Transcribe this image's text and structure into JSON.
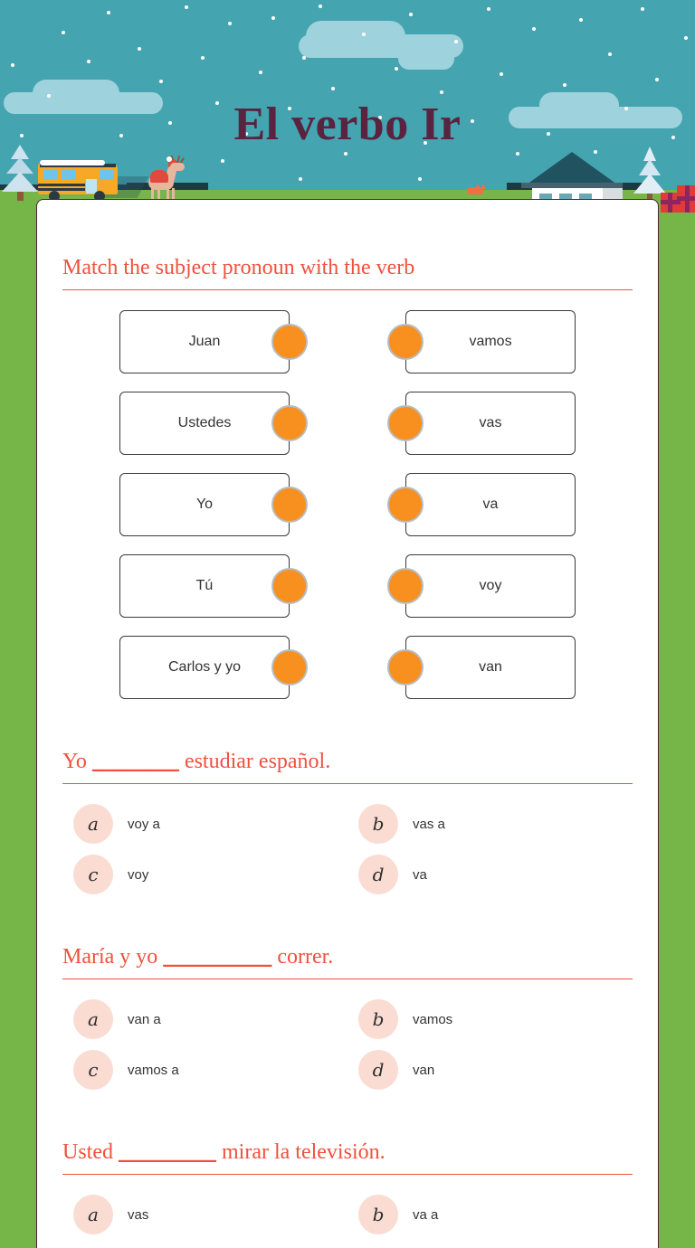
{
  "page": {
    "title": "El verbo Ir",
    "theme_colors": {
      "sky": "#44a4b0",
      "grass": "#76b547",
      "title": "#5a2340",
      "accent_red": "#f0503c",
      "match_dot": "#f7901e",
      "option_circle": "#fadcd2"
    }
  },
  "matching": {
    "heading": "Match the subject pronoun with the verb",
    "rows": [
      {
        "left": "Juan",
        "right": "vamos"
      },
      {
        "left": "Ustedes",
        "right": "vas"
      },
      {
        "left": "Yo",
        "right": "va"
      },
      {
        "left": "Tú",
        "right": "voy"
      },
      {
        "left": "Carlos y yo",
        "right": "van"
      }
    ]
  },
  "questions": [
    {
      "prefix": "Yo ",
      "blank": "________",
      "suffix": " estudiar español.",
      "full_text": "Yo ________ estudiar español.",
      "options": [
        {
          "letter": "a",
          "text": "voy a"
        },
        {
          "letter": "b",
          "text": "vas a"
        },
        {
          "letter": "c",
          "text": "voy"
        },
        {
          "letter": "d",
          "text": "va"
        }
      ]
    },
    {
      "prefix": "María y yo ",
      "blank": "__________",
      "suffix": " correr.",
      "full_text": "María y yo __________ correr.",
      "options": [
        {
          "letter": "a",
          "text": "van a"
        },
        {
          "letter": "b",
          "text": "vamos"
        },
        {
          "letter": "c",
          "text": "vamos a"
        },
        {
          "letter": "d",
          "text": "van"
        }
      ]
    },
    {
      "prefix": "Usted ",
      "blank": "_________",
      "suffix": " mirar la televisión.",
      "full_text": "Usted _________ mirar la televisión.",
      "options": [
        {
          "letter": "a",
          "text": "vas"
        },
        {
          "letter": "b",
          "text": "va a"
        }
      ]
    }
  ],
  "decorations": {
    "scene_items": [
      "school-bus-icon",
      "reindeer-icon",
      "fox-icon",
      "house-icon",
      "pine-tree-icon",
      "gift-boxes-icon",
      "cloud-icon",
      "snowflake-icon"
    ]
  }
}
